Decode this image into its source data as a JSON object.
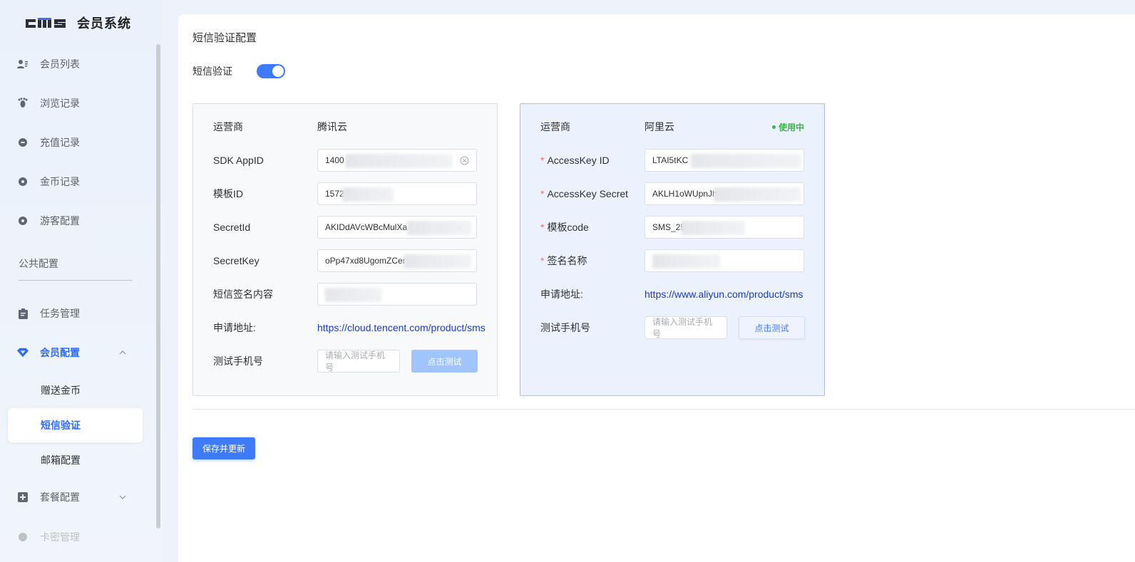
{
  "brand": {
    "logo_text": "cms",
    "name": "会员系统"
  },
  "sidebar": {
    "items": [
      {
        "label": "会员列表",
        "icon": "users-icon"
      },
      {
        "label": "浏览记录",
        "icon": "footprint-icon"
      },
      {
        "label": "充值记录",
        "icon": "coin-icon"
      },
      {
        "label": "金币记录",
        "icon": "gold-icon"
      },
      {
        "label": "游客配置",
        "icon": "guest-icon"
      }
    ],
    "group_label": "公共配置",
    "task": {
      "label": "任务管理",
      "icon": "clipboard-icon"
    },
    "member_config": {
      "label": "会员配置",
      "icon": "diamond-icon",
      "children": [
        {
          "label": "赠送金币"
        },
        {
          "label": "短信验证"
        },
        {
          "label": "邮箱配置"
        }
      ]
    },
    "package": {
      "label": "套餐配置",
      "icon": "plus-square-icon"
    },
    "card_secret": {
      "label": "卡密管理",
      "icon": "card-icon"
    }
  },
  "main": {
    "title": "短信验证配置",
    "toggle_label": "短信验证",
    "toggle_on": true,
    "save_button": "保存并更新"
  },
  "tencent": {
    "provider_label": "运营商",
    "provider": "腾讯云",
    "sdk_label": "SDK AppID",
    "sdk_value": "1400",
    "template_label": "模板ID",
    "template_value": "1572",
    "secret_id_label": "SecretId",
    "secret_id_value": "AKIDdAVcWBcMulXa",
    "secret_key_label": "SecretKey",
    "secret_key_value": "oPp47xd8UgomZCer",
    "sign_label": "短信签名内容",
    "sign_value": "",
    "apply_label": "申请地址:",
    "apply_url": "https://cloud.tencent.com/product/sms",
    "phone_label": "测试手机号",
    "phone_placeholder": "请输入测试手机号",
    "test_button": "点击测试"
  },
  "aliyun": {
    "provider_label": "运营商",
    "provider": "阿里云",
    "status": "使用中",
    "access_id_label": "AccessKey ID",
    "access_id_value": "LTAI5tKC",
    "access_secret_label": "AccessKey Secret",
    "access_secret_value": "AKLH1oWUpnJh",
    "template_label": "模板code",
    "template_value": "SMS_25",
    "sign_label": "签名名称",
    "sign_value": "",
    "apply_label": "申请地址:",
    "apply_url": "https://www.aliyun.com/product/sms",
    "phone_label": "测试手机号",
    "phone_placeholder": "请输入测试手机号",
    "test_button": "点击测试"
  },
  "colors": {
    "accent": "#3e7bfa",
    "status": "#3bb54a",
    "link": "#1a3cc8"
  }
}
